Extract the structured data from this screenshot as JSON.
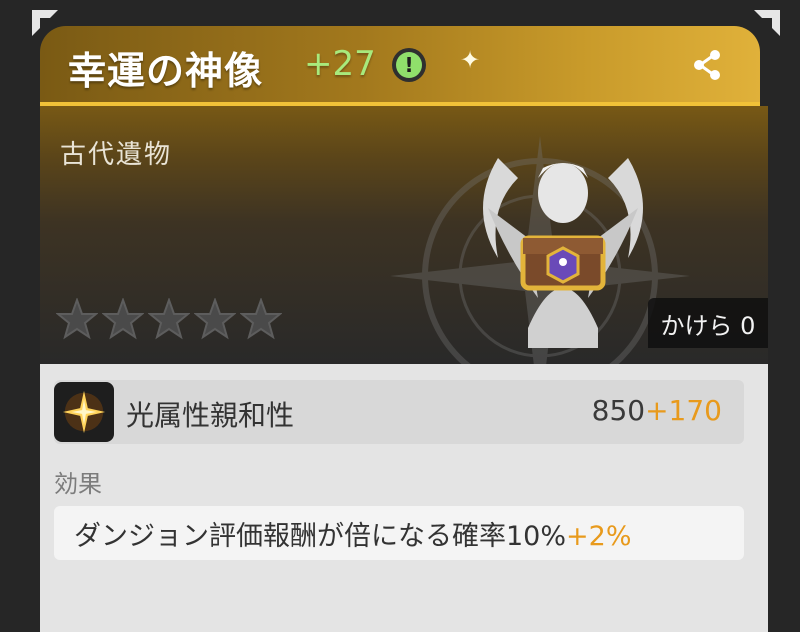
{
  "header": {
    "title": "幸運の神像",
    "level_bonus": "+27",
    "info_symbol": "!"
  },
  "banner": {
    "category": "古代遺物",
    "rarity_stars": 5,
    "fragments_label": "かけら 0"
  },
  "stat": {
    "name": "光属性親和性",
    "base": "850",
    "bonus": "+170"
  },
  "effect": {
    "heading": "効果",
    "text": "ダンジョン評価報酬が倍になる確率10%",
    "bonus": "+2%"
  },
  "colors": {
    "gold_header": "#c89a2a",
    "green_level": "#a8ea7c",
    "orange_bonus": "#e89a1c",
    "panel_bg": "#e4e4e4"
  }
}
